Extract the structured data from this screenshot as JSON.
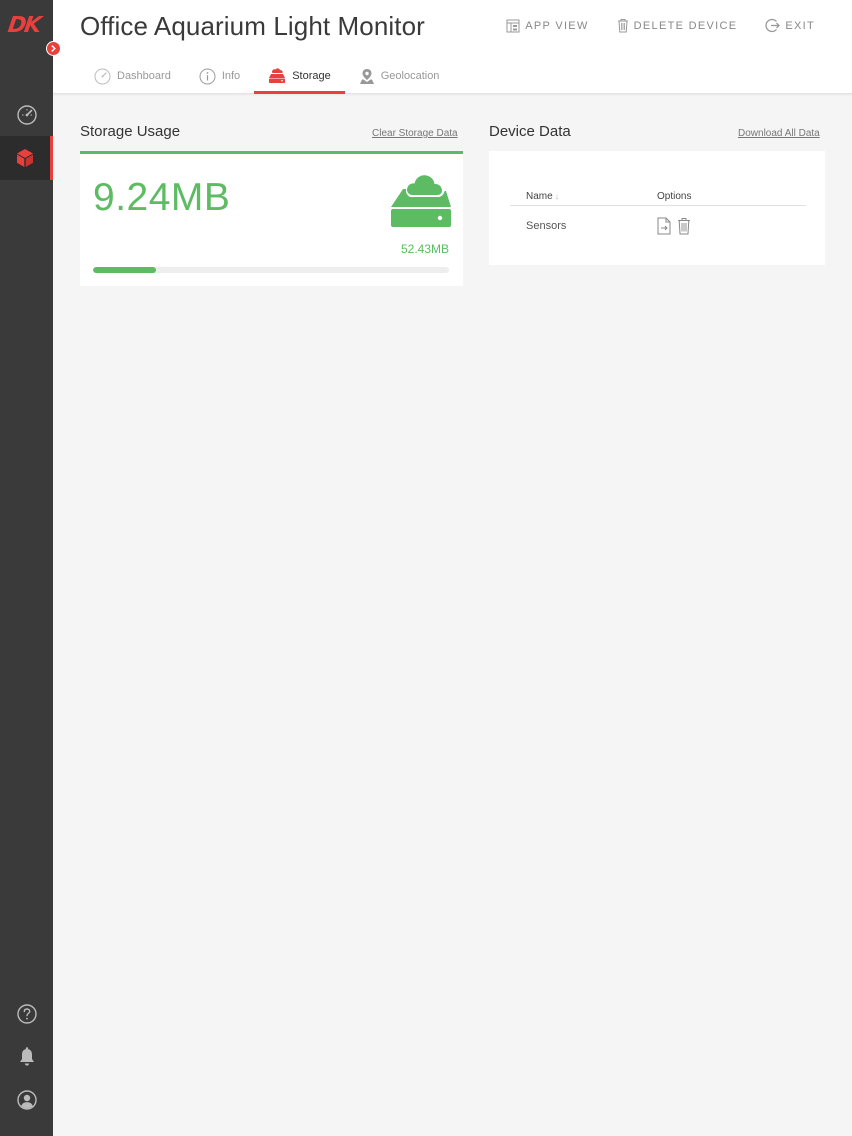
{
  "app": {
    "logo_text": "DK",
    "title": "Office Aquarium Light Monitor"
  },
  "header_actions": [
    {
      "label": "APP VIEW",
      "icon": "app-view-icon"
    },
    {
      "label": "DELETE DEVICE",
      "icon": "trash-icon"
    },
    {
      "label": "EXIT",
      "icon": "exit-icon"
    }
  ],
  "tabs": [
    {
      "label": "Dashboard",
      "icon": "gauge-icon",
      "active": false
    },
    {
      "label": "Info",
      "icon": "info-icon",
      "active": false
    },
    {
      "label": "Storage",
      "icon": "storage-icon",
      "active": true
    },
    {
      "label": "Geolocation",
      "icon": "location-pin-icon",
      "active": false
    }
  ],
  "sidebar": {
    "top_items": [
      {
        "icon": "gauge-icon",
        "active": false
      },
      {
        "icon": "cube-icon",
        "active": true
      }
    ],
    "bottom_items": [
      {
        "icon": "help-icon"
      },
      {
        "icon": "bell-icon"
      },
      {
        "icon": "user-icon"
      }
    ]
  },
  "storage": {
    "title": "Storage Usage",
    "clear_link": "Clear Storage Data",
    "used": "9.24MB",
    "total": "52.43MB",
    "used_fraction": 0.176
  },
  "device_data": {
    "title": "Device Data",
    "download_link": "Download All Data",
    "columns": {
      "name": "Name",
      "options": "Options"
    },
    "rows": [
      {
        "name": "Sensors"
      }
    ]
  },
  "colors": {
    "accent": "#e8403d",
    "success": "#5dbb63",
    "sidebar": "#3a3a3a"
  }
}
